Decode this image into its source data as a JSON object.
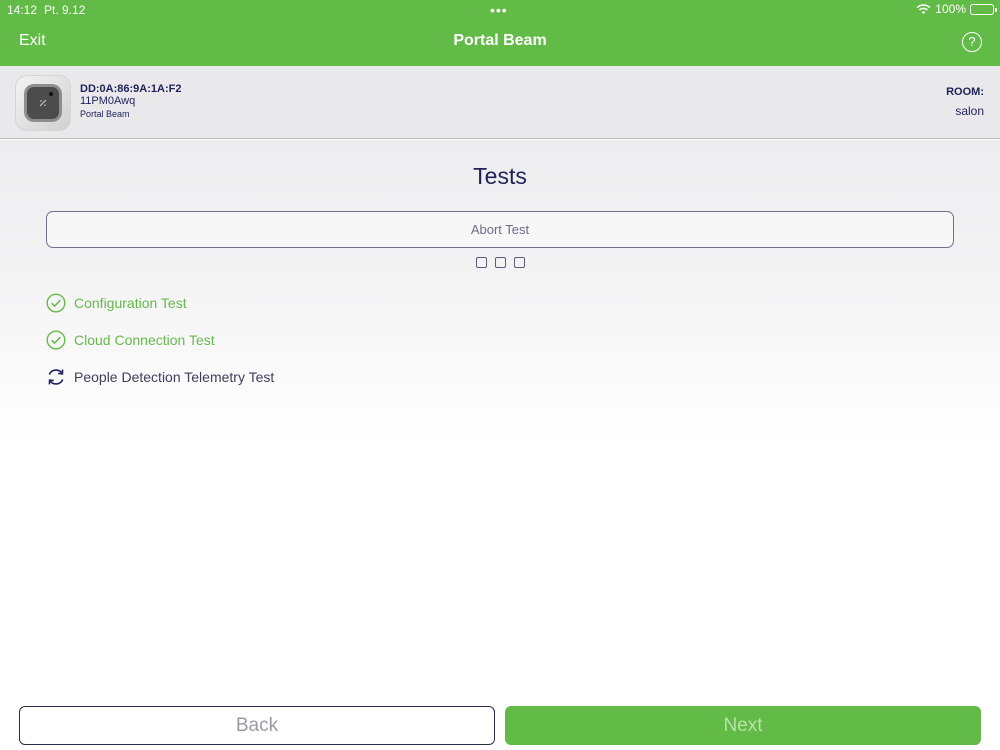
{
  "status_bar": {
    "time": "14:12",
    "date": "Pt. 9.12",
    "dots": "•••",
    "battery": "100%"
  },
  "nav": {
    "exit_label": "Exit",
    "title": "Portal Beam",
    "help_symbol": "?"
  },
  "device": {
    "mac": "DD:0A:86:9A:1A:F2",
    "id": "11PM0Awq",
    "type": "Portal Beam",
    "room_label": "ROOM:",
    "room_value": "salon"
  },
  "main": {
    "title": "Tests",
    "abort_label": "Abort Test",
    "tests": [
      {
        "label": "Configuration Test",
        "status": "passed"
      },
      {
        "label": "Cloud Connection Test",
        "status": "passed"
      },
      {
        "label": "People Detection Telemetry Test",
        "status": "in-progress"
      }
    ]
  },
  "footer": {
    "back_label": "Back",
    "next_label": "Next"
  },
  "colors": {
    "brand_green": "#62bb46",
    "navy_text": "#1f2158",
    "passed_green": "#66b94b"
  }
}
